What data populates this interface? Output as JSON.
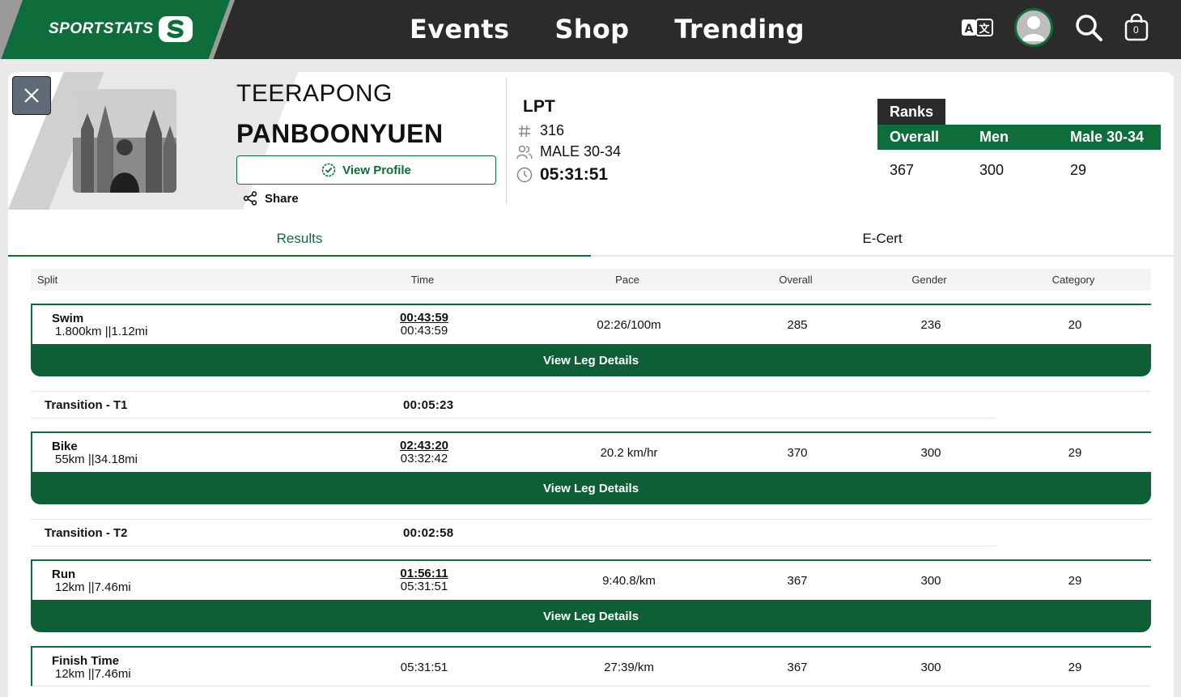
{
  "brand": {
    "name": "SPORTSTATS",
    "accent": "#0e6d3b",
    "dark": "#2b2b2b"
  },
  "nav": {
    "items": [
      "Events",
      "Shop",
      "Trending"
    ],
    "cart_count": "0"
  },
  "athlete": {
    "first_name": "TEERAPONG",
    "last_name": "PANBOONYUEN",
    "view_profile_label": "View Profile",
    "share_label": "Share",
    "race": "LPT",
    "bib": "316",
    "category": "MALE 30-34",
    "finish_time": "05:31:51"
  },
  "ranks": {
    "title": "Ranks",
    "headers": [
      "Overall",
      "Men",
      "Male 30-34"
    ],
    "values": [
      "367",
      "300",
      "29"
    ]
  },
  "tabs": {
    "results": "Results",
    "ecert": "E-Cert"
  },
  "table": {
    "headers": {
      "split": "Split",
      "time": "Time",
      "pace": "Pace",
      "overall": "Overall",
      "gender": "Gender",
      "category": "Category"
    },
    "legs": [
      {
        "name": "Swim",
        "distance": "1.800km ||1.12mi",
        "split_time": "00:43:59",
        "cumulative": "00:43:59",
        "pace": "02:26/100m",
        "overall": "285",
        "gender": "236",
        "category": "20",
        "button": "View Leg Details"
      },
      {
        "name": "Bike",
        "distance": "55km ||34.18mi",
        "split_time": "02:43:20",
        "cumulative": "03:32:42",
        "pace": "20.2 km/hr",
        "overall": "370",
        "gender": "300",
        "category": "29",
        "button": "View Leg Details"
      },
      {
        "name": "Run",
        "distance": "12km ||7.46mi",
        "split_time": "01:56:11",
        "cumulative": "05:31:51",
        "pace": "9:40.8/km",
        "overall": "367",
        "gender": "300",
        "category": "29",
        "button": "View Leg Details"
      }
    ],
    "transitions": [
      {
        "name": "Transition - T1",
        "time": "00:05:23"
      },
      {
        "name": "Transition - T2",
        "time": "00:02:58"
      }
    ],
    "finish": {
      "name": "Finish Time",
      "distance": "12km ||7.46mi",
      "time": "05:31:51",
      "pace": "27:39/km",
      "overall": "367",
      "gender": "300",
      "category": "29"
    }
  }
}
